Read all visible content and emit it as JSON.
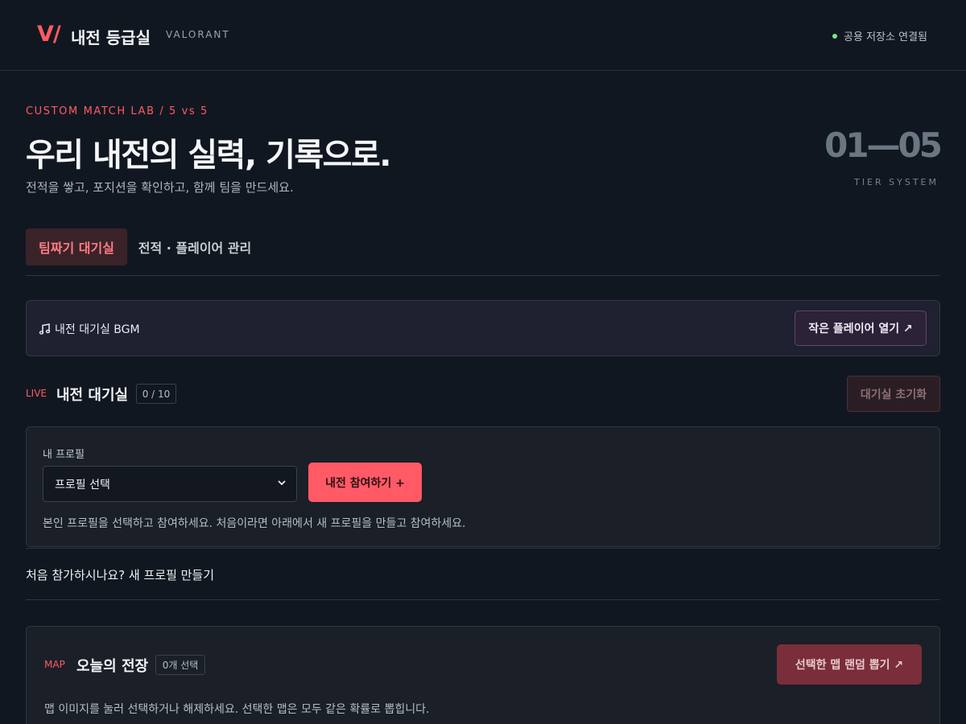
{
  "header": {
    "logo": "V/",
    "title": "내전 등급실",
    "subtitle": "VALORANT",
    "status": "공용 저장소 연결됨",
    "status_color": "#7ee08f"
  },
  "hero": {
    "eyebrow": "CUSTOM MATCH LAB / 5 vs 5",
    "title": "우리 내전의 실력, 기록으로.",
    "description": "전적을 쌓고, 포지션을 확인하고, 함께 팀을 만드세요.",
    "tier_range": "01—05",
    "tier_label": "TIER SYSTEM"
  },
  "tabs": [
    {
      "label": "팀짜기 대기실",
      "active": true
    },
    {
      "label": "전적 · 플레이어 관리",
      "active": false
    }
  ],
  "bgm": {
    "icon": "music-note-icon",
    "label": "내전 대기실 BGM",
    "button": "작은 플레이어 열기 ↗"
  },
  "lobby": {
    "live": "LIVE",
    "title": "내전 대기실",
    "count": "0 / 10",
    "reset": "대기실 초기화"
  },
  "profile": {
    "label": "내 프로필",
    "select_value": "프로필 선택",
    "join": "내전 참여하기 +",
    "hint": "본인 프로필을 선택하고 참여하세요. 처음이라면 아래에서 새 프로필을 만들고 참여하세요."
  },
  "new_profile": {
    "text": "처음 참가하시나요? 새 프로필 만들기"
  },
  "map": {
    "tag": "MAP",
    "title": "오늘의 전장",
    "badge": "0개 선택",
    "button": "선택한 맵 랜덤 뽑기 ↗",
    "hint": "맵 이미지를 눌러 선택하거나 해제하세요. 선택한 맵은 모두 같은 확률로 뽑힙니다."
  },
  "colors": {
    "accent": "#ff5a65",
    "background": "#111720"
  }
}
